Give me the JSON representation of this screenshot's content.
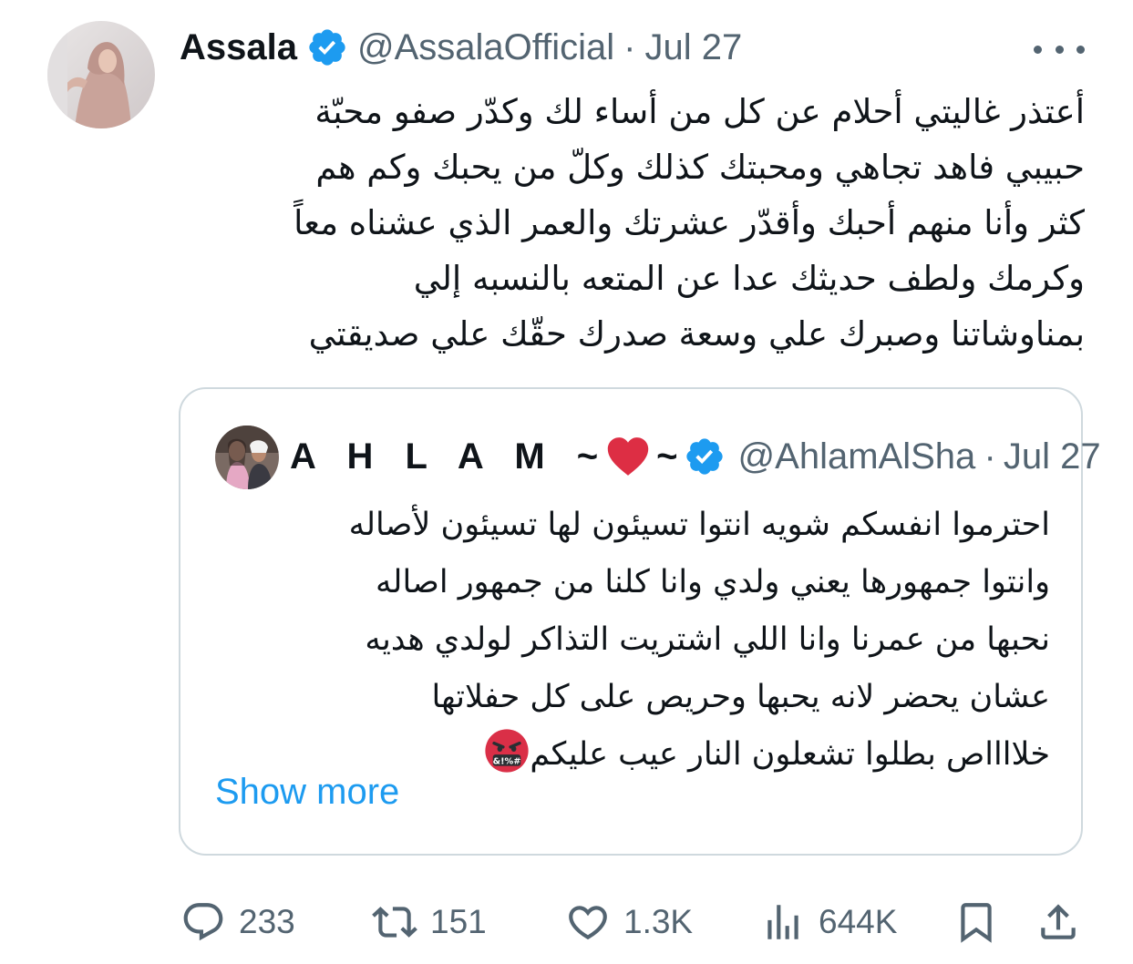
{
  "tweet": {
    "author": {
      "display_name": "Assala",
      "handle": "@AssalaOfficial",
      "separator": "·",
      "time": "Jul 27",
      "verified": true
    },
    "text_lines": [
      "أعتذر غاليتي أحلام عن كل من أساء لك وكدّر صفو محبّة",
      "حبيبي فاهد تجاهي ومحبتك كذلك وكلّ من يحبك وكم هم",
      "كثر وأنا منهم أحبك وأقدّر عشرتك والعمر الذي عشناه معاً",
      "وكرمك ولطف حديثك عدا عن المتعه بالنسبه إلي",
      "بمناوشاتنا وصبرك علي وسعة صدرك حقّك علي صديقتي"
    ]
  },
  "quoted_tweet": {
    "author": {
      "display_name": "A H L A M ~",
      "name_suffix": "~",
      "handle": "@AhlamAlShamsi",
      "separator": "·",
      "time": "Jul 27",
      "verified": true
    },
    "text_lines": [
      "احترموا انفسكم شويه انتوا تسيئون لها تسيئون لأصاله",
      "وانتوا جمهورها يعني ولدي وانا كلنا من جمهور اصاله",
      "نحبها من عمرنا وانا اللي اشتريت التذاكر لولدي هديه",
      "عشان يحضر لانه يحبها وحريص على كل حفلاتها",
      "خلااااص بطلوا تشعلون النار عيب عليكم"
    ],
    "show_more_label": "Show more"
  },
  "actions": {
    "replies": "233",
    "reposts": "151",
    "likes": "1.3K",
    "views": "644K"
  },
  "colors": {
    "text_primary": "#0f1419",
    "text_secondary": "#536471",
    "accent_blue": "#1d9bf0",
    "border": "#cfd9de",
    "heart_red": "#dd2e44"
  },
  "icons": {
    "verified": "verified-badge-icon",
    "more": "more-horizontal-icon",
    "reply": "reply-bubble-icon",
    "repost": "repost-arrows-icon",
    "like": "heart-outline-icon",
    "views": "bar-chart-icon",
    "bookmark": "bookmark-icon",
    "share": "share-upload-icon"
  }
}
